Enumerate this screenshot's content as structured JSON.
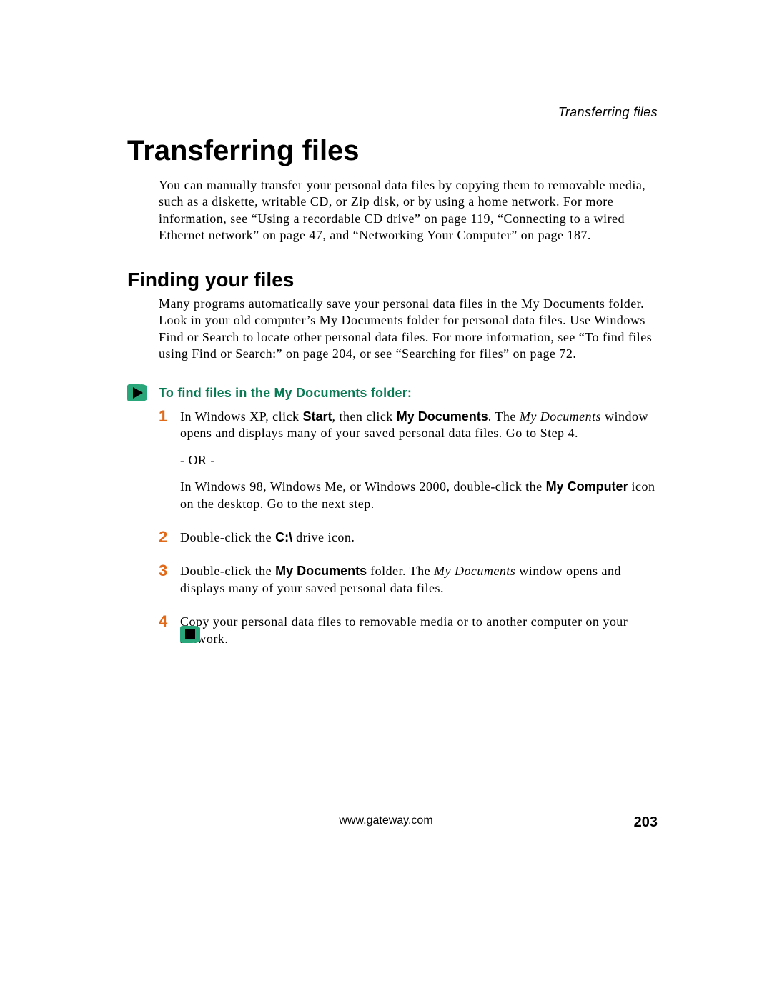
{
  "header": {
    "running": "Transferring files"
  },
  "title": "Transferring files",
  "intro": "You can manually transfer your personal data files by copying them to removable media, such as a diskette, writable CD, or Zip disk, or by using a home network. For more information, see “Using a recordable CD drive” on page 119, “Connecting to a wired Ethernet network” on page 47, and “Networking Your Computer” on page 187.",
  "subtitle": "Finding your files",
  "para2": "Many programs automatically save your personal data files in the My Documents folder. Look in your old computer’s My Documents folder for personal data files. Use Windows Find or Search to locate other personal data files. For more information, see “To find files using Find or Search:” on page 204, or see “Searching for files” on page 72.",
  "procedure_heading": "To find files in the My Documents folder:",
  "steps": {
    "s1": {
      "num": "1",
      "a1": "In Windows XP, click ",
      "a2": "Start",
      "a3": ", then click ",
      "a4": "My Documents",
      "a5": ". The ",
      "a6": "My Documents",
      "a7": " window opens and displays many of your saved personal data files. Go to Step 4.",
      "or": "- OR -",
      "b1": "In Windows 98, Windows Me, or Windows 2000, double-click the ",
      "b2": "My Computer",
      "b3": " icon on the desktop. Go to the next step."
    },
    "s2": {
      "num": "2",
      "a1": "Double-click the ",
      "a2": "C:\\",
      "a3": " drive icon."
    },
    "s3": {
      "num": "3",
      "a1": "Double-click the ",
      "a2": "My Documents",
      "a3": " folder. The ",
      "a4": "My Documents",
      "a5": " window opens and displays many of your saved personal data files."
    },
    "s4": {
      "num": "4",
      "a1": "Copy your personal data files to removable media or to another computer on your network."
    }
  },
  "footer": {
    "url": "www.gateway.com",
    "page": "203"
  }
}
